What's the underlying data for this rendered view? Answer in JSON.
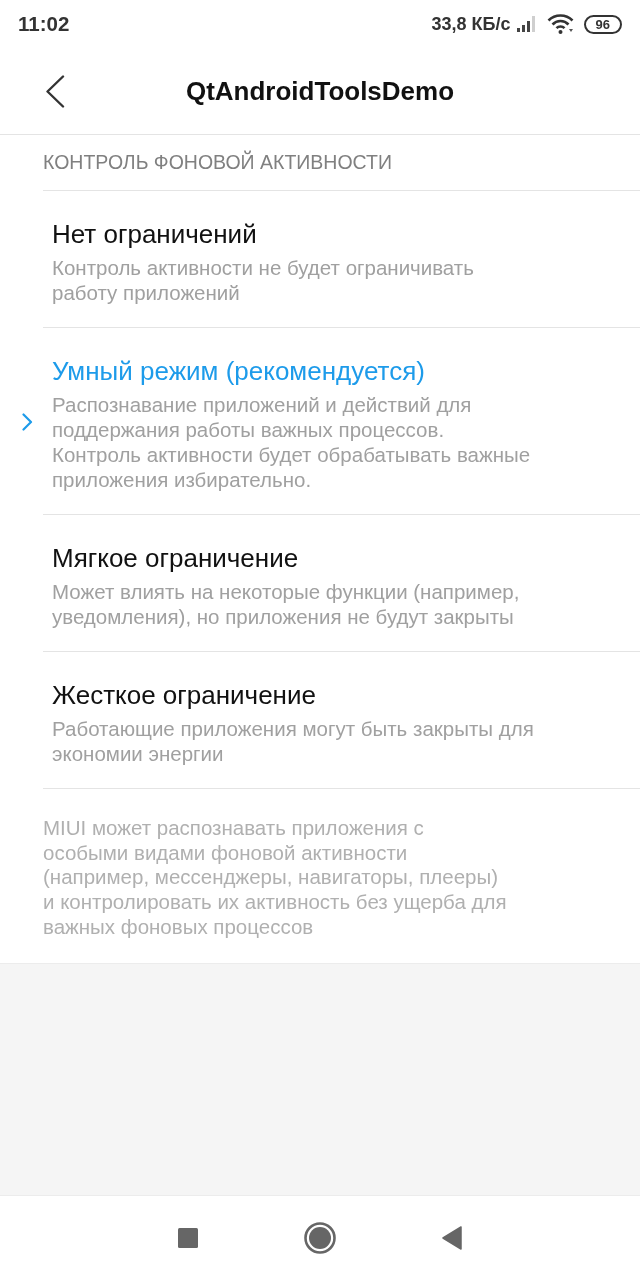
{
  "status_bar": {
    "time": "11:02",
    "network_speed": "33,8 КБ/с",
    "battery": "96"
  },
  "app_bar": {
    "title": "QtAndroidToolsDemo"
  },
  "section": {
    "header": "КОНТРОЛЬ ФОНОВОЙ АКТИВНОСТИ",
    "options": [
      {
        "title": "Нет ограничений",
        "description": "Контроль активности не будет ограничивать\nработу приложений",
        "selected": false
      },
      {
        "title": "Умный режим (рекомендуется)",
        "description": "Распознавание приложений и действий для\nподдержания работы важных процессов.\nКонтроль активности будет обрабатывать важные\nприложения избирательно.",
        "selected": true
      },
      {
        "title": "Мягкое ограничение",
        "description": "Может влиять на некоторые функции (например,\nуведомления), но приложения не будут закрыты",
        "selected": false
      },
      {
        "title": "Жесткое ограничение",
        "description": "Работающие приложения могут быть закрыты для\nэкономии энергии",
        "selected": false
      }
    ]
  },
  "note": "MIUI может распознавать приложения с\nособыми видами фоновой активности\n(например, мессенджеры, навигаторы, плееры)\nи контролировать их активность без ущерба для\nважных фоновых процессов"
}
